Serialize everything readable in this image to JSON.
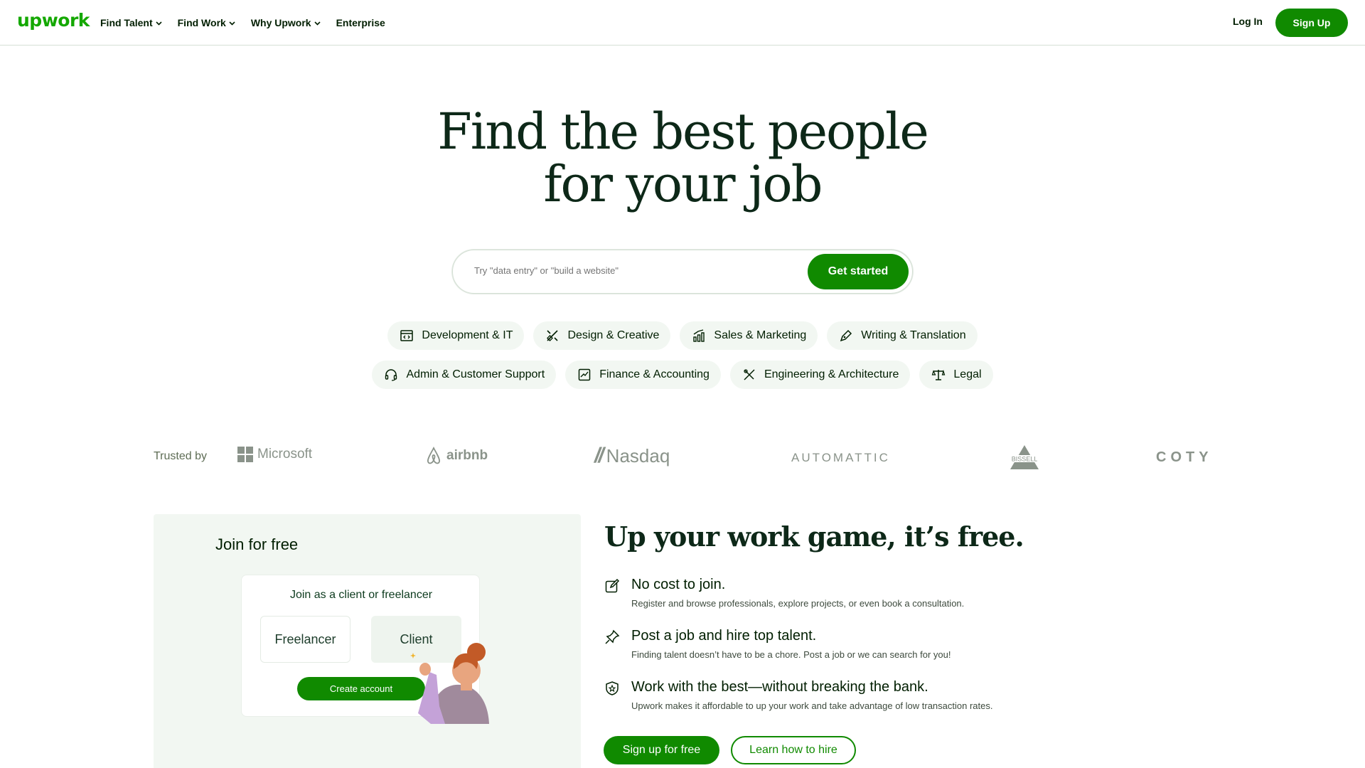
{
  "header": {
    "logo": "upwork",
    "nav": [
      {
        "label": "Find Talent",
        "has_dropdown": true
      },
      {
        "label": "Find Work",
        "has_dropdown": true
      },
      {
        "label": "Why Upwork",
        "has_dropdown": true
      },
      {
        "label": "Enterprise",
        "has_dropdown": false
      }
    ],
    "login": "Log In",
    "signup": "Sign Up"
  },
  "hero": {
    "title_line1": "Find the best people",
    "title_line2": "for your job",
    "search_placeholder": "Try \"data entry\" or \"build a website\"",
    "search_button": "Get started"
  },
  "categories": {
    "row1": [
      {
        "label": "Development & IT",
        "icon": "code-window-icon"
      },
      {
        "label": "Design & Creative",
        "icon": "design-tools-icon"
      },
      {
        "label": "Sales & Marketing",
        "icon": "growth-chart-icon"
      },
      {
        "label": "Writing & Translation",
        "icon": "pen-icon"
      }
    ],
    "row2": [
      {
        "label": "Admin & Customer Support",
        "icon": "headset-icon"
      },
      {
        "label": "Finance & Accounting",
        "icon": "trend-chart-icon"
      },
      {
        "label": "Engineering & Architecture",
        "icon": "compass-ruler-icon"
      },
      {
        "label": "Legal",
        "icon": "scales-icon"
      }
    ]
  },
  "trusted": {
    "label": "Trusted by",
    "brands": [
      "Microsoft",
      "airbnb",
      "Nasdaq",
      "AUTOMATTIC",
      "BISSELL",
      "COTY"
    ]
  },
  "join": {
    "title": "Join for free",
    "card_title": "Join as a client or freelancer",
    "freelancer": "Freelancer",
    "client": "Client",
    "create": "Create account"
  },
  "benefits": {
    "title": "Up your work game, it’s free.",
    "items": [
      {
        "title": "No cost to join.",
        "desc": "Register and browse professionals, explore projects, or even book a consultation.",
        "icon": "edit-icon"
      },
      {
        "title": "Post a job and hire top talent.",
        "desc": "Finding talent doesn’t have to be a chore. Post a job or we can search for you!",
        "icon": "pin-icon"
      },
      {
        "title": "Work with the best—without breaking the bank.",
        "desc": "Upwork makes it affordable to up your work and take advantage of low transaction rates.",
        "icon": "shield-star-icon"
      }
    ],
    "primary_cta": "Sign up for free",
    "secondary_cta": "Learn how to hire"
  },
  "colors": {
    "brand_green": "#108a00",
    "logo_green": "#14a800",
    "text_dark": "#001e00",
    "pill_bg": "#f2f7f2"
  }
}
